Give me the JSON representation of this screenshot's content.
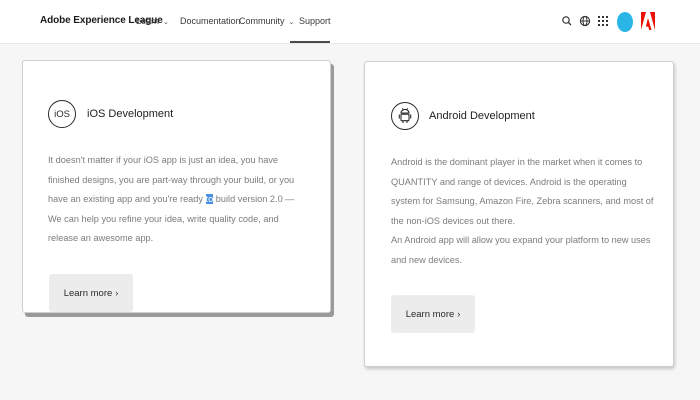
{
  "header": {
    "brand": "Adobe Experience League",
    "nav": [
      {
        "label": "Learn",
        "dropdown": true
      },
      {
        "label": "Documentation",
        "dropdown": false
      },
      {
        "label": "Community",
        "dropdown": true
      },
      {
        "label": "Support",
        "dropdown": false,
        "active": true
      }
    ],
    "icons": [
      "search-icon",
      "globe-icon",
      "apps-grid-icon",
      "avatar",
      "adobe-logo"
    ]
  },
  "cards": [
    {
      "icon_label": "iOS",
      "title": "iOS Development",
      "description_before": "It doesn't matter if your iOS app is just an idea, you have finished designs, you are part-way through your build, or you have an existing app and you're ready ",
      "description_highlight": "to",
      "description_after": " build version 2.0 — We can help you refine your idea, write quality code, and release an awesome app.",
      "button": "Learn more"
    },
    {
      "icon_label": "android",
      "title": "Android Development",
      "paragraph1": "Android is the dominant player in the market when it comes to QUANTITY and range of devices. Android is the operating system for Samsung, Amazon Fire, Zebra scanners, and most of the non-iOS devices out there.",
      "paragraph2": "An Android app will allow you expand your platform to new uses and new devices.",
      "button": "Learn more"
    }
  ],
  "colors": {
    "accent_avatar": "#29b6e6",
    "adobe_red": "#eb1000",
    "text_selection": "#4a90e2"
  }
}
